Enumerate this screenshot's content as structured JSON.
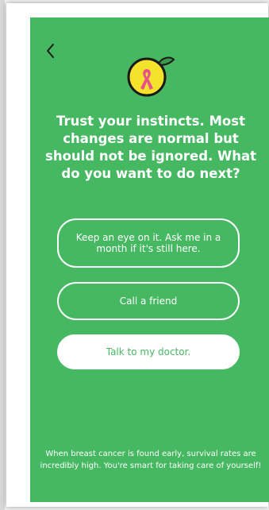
{
  "screen": {
    "background": "#46b862",
    "back_icon": "chevron-left-icon",
    "logo_icon": "lemon-pink-ribbon-icon"
  },
  "question": "Trust your instincts. Most changes are normal but should not be ignored. What do you want to do next?",
  "options": [
    {
      "label": "Keep an eye on it. Ask me in a month if it's still here."
    },
    {
      "label": "Call a friend"
    },
    {
      "label": "Talk to my doctor."
    }
  ],
  "footer": "When breast cancer is found early, survival rates are incredibly high. You're smart for taking care of yourself!",
  "colors": {
    "green": "#46b862",
    "lemon": "#f5e22b",
    "leaf": "#3a9a4a",
    "ribbon": "#e8528a",
    "white": "#ffffff"
  }
}
